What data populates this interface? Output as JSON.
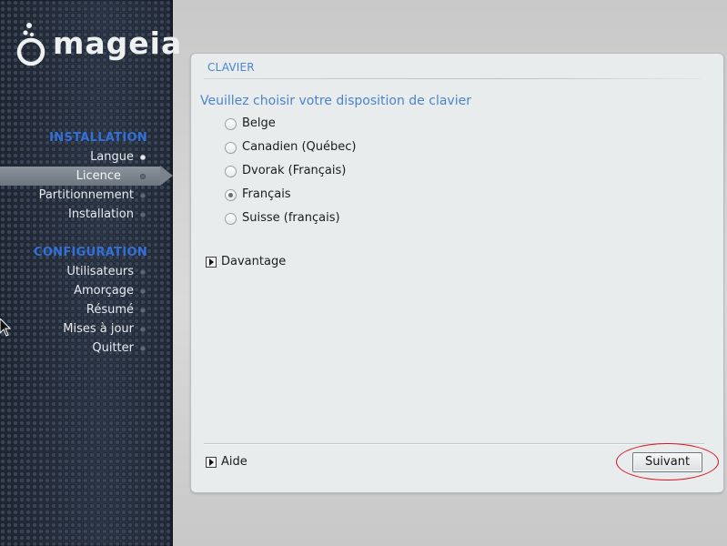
{
  "brand": {
    "name": "mageia"
  },
  "sidebar": {
    "sections": [
      {
        "title": "INSTALLATION"
      },
      {
        "title": "CONFIGURATION"
      }
    ],
    "installation_items": [
      {
        "label": "Langue",
        "state": "done"
      },
      {
        "label": "Licence",
        "state": "active"
      },
      {
        "label": "Partitionnement",
        "state": "pending"
      },
      {
        "label": "Installation",
        "state": "pending"
      }
    ],
    "configuration_items": [
      {
        "label": "Utilisateurs",
        "state": "pending"
      },
      {
        "label": "Amorçage",
        "state": "pending"
      },
      {
        "label": "Résumé",
        "state": "pending"
      },
      {
        "label": "Mises à jour",
        "state": "pending"
      },
      {
        "label": "Quitter",
        "state": "pending"
      }
    ]
  },
  "panel": {
    "title": "CLAVIER",
    "prompt": "Veuillez choisir votre disposition de clavier",
    "options": [
      {
        "label": "Belge",
        "selected": false
      },
      {
        "label": "Canadien (Québec)",
        "selected": false
      },
      {
        "label": "Dvorak (Français)",
        "selected": false
      },
      {
        "label": "Français",
        "selected": true
      },
      {
        "label": "Suisse (français)",
        "selected": false
      }
    ],
    "more_label": "Davantage",
    "help_label": "Aide",
    "next_label": "Suivant"
  },
  "colors": {
    "accent": "#4b84cc",
    "section_title": "#3370d8",
    "highlight": "#d9121b"
  },
  "icons": [
    "mageia-logo-icon",
    "expander-arrow-icon",
    "mouse-pointer-icon"
  ]
}
